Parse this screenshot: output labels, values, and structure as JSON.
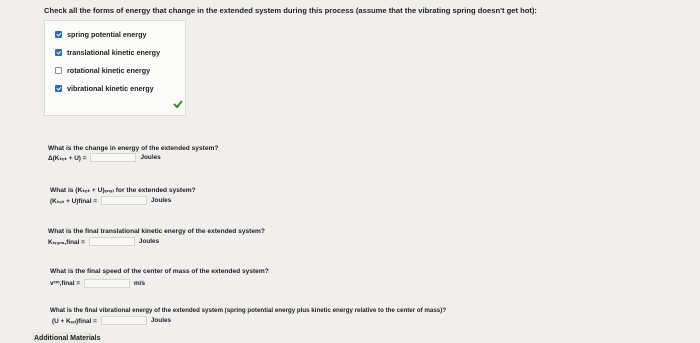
{
  "question": {
    "text": "Check all the forms of energy that change in the extended system during this process (assume that the vibrating spring doesn't get hot):"
  },
  "options": [
    {
      "label": "spring potential energy",
      "checked": true
    },
    {
      "label": "translational kinetic energy",
      "checked": true
    },
    {
      "label": "rotational kinetic energy",
      "checked": false
    },
    {
      "label": "vibrational kinetic energy",
      "checked": true
    }
  ],
  "questions": [
    {
      "prompt": "What is the change in energy of the extended system?",
      "label": "Δ(Kₜₒₜ + U) =",
      "unit": "Joules"
    },
    {
      "prompt": "What is (Kₜₒₜ + U)ₑₙₐₗ for the extended system?",
      "label": "(Kₜₒₜ + U)final =",
      "unit": "Joules"
    },
    {
      "prompt": "What is the final translational kinetic energy of the extended system?",
      "label": "Kₜᵣₐₙₛ,final =",
      "unit": "Joules"
    },
    {
      "prompt": "What is the final speed of the center of mass of the extended system?",
      "label": "vᶜᵐ,final =",
      "unit": "m/s"
    },
    {
      "prompt": "What is the final vibrational energy of the extended system (spring potential energy plus kinetic energy relative to the center of mass)?",
      "label": "(U + Kᵣₑₗ)final =",
      "unit": "Joules"
    }
  ],
  "footer": {
    "label": "Additional Materials"
  },
  "colors": {
    "check_blue": "#2d6cb0",
    "correct_green": "#3a8a2f"
  }
}
